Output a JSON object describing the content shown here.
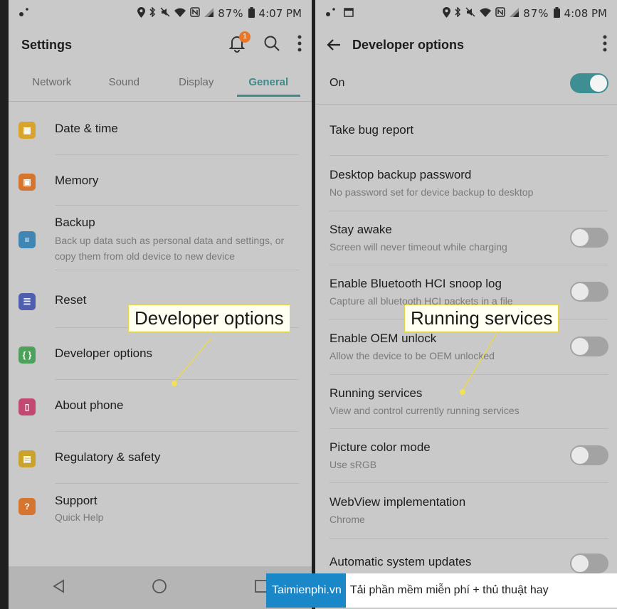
{
  "left": {
    "status": {
      "battery": "87%",
      "time": "4:07 PM"
    },
    "title": "Settings",
    "badge": "1",
    "tabs": [
      {
        "label": "Network",
        "active": false
      },
      {
        "label": "Sound",
        "active": false
      },
      {
        "label": "Display",
        "active": false
      },
      {
        "label": "General",
        "active": true
      }
    ],
    "items": [
      {
        "label": "Date & time",
        "sub": "",
        "icon": "calendar-icon",
        "color": "#d9a42b"
      },
      {
        "label": "Memory",
        "sub": "",
        "icon": "chip-icon",
        "color": "#d6752f"
      },
      {
        "label": "Backup",
        "sub": "Back up data such as personal data and settings, or copy them from old device to new device",
        "icon": "backup-icon",
        "color": "#3f86b4"
      },
      {
        "label": "Reset",
        "sub": "",
        "icon": "reset-icon",
        "color": "#505eb0"
      },
      {
        "label": "Developer options",
        "sub": "",
        "icon": "code-braces-icon",
        "color": "#4da25b"
      },
      {
        "label": "About phone",
        "sub": "",
        "icon": "phone-info-icon",
        "color": "#c24a72"
      },
      {
        "label": "Regulatory & safety",
        "sub": "",
        "icon": "regulatory-icon",
        "color": "#cba32b"
      },
      {
        "label": "Support",
        "sub": "Quick Help",
        "icon": "support-icon",
        "color": "#d6752f"
      }
    ],
    "callout": "Developer options"
  },
  "right": {
    "status": {
      "battery": "87%",
      "time": "4:08 PM"
    },
    "title": "Developer options",
    "on_label": "On",
    "items": [
      {
        "label": "Take bug report",
        "sub": "",
        "toggle": null
      },
      {
        "label": "Desktop backup password",
        "sub": "No password set for device backup to desktop",
        "toggle": null
      },
      {
        "label": "Stay awake",
        "sub": "Screen will never timeout while charging",
        "toggle": false
      },
      {
        "label": "Enable Bluetooth HCI snoop log",
        "sub": "Capture all bluetooth HCI packets in a file",
        "toggle": false
      },
      {
        "label": "Enable OEM unlock",
        "sub": "Allow the device to be OEM unlocked",
        "toggle": false
      },
      {
        "label": "Running services",
        "sub": "View and control currently running services",
        "toggle": null
      },
      {
        "label": "Picture color mode",
        "sub": "Use sRGB",
        "toggle": false
      },
      {
        "label": "WebView implementation",
        "sub": "Chrome",
        "toggle": null
      },
      {
        "label": "Automatic system updates",
        "sub": "",
        "toggle": false
      }
    ],
    "callout": "Running services"
  },
  "banner": {
    "brand": "Taimienphi.vn",
    "tagline": "Tải phần mềm miễn phí + thủ thuật hay"
  }
}
